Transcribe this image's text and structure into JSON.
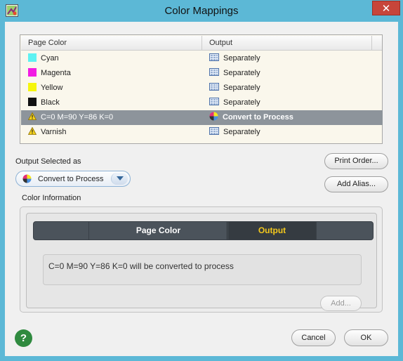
{
  "window": {
    "title": "Color Mappings"
  },
  "table": {
    "headers": {
      "page_color": "Page Color",
      "output": "Output"
    },
    "rows": [
      {
        "name": "Cyan",
        "swatch": "#5ef2f2",
        "output": "Separately"
      },
      {
        "name": "Magenta",
        "swatch": "#f21ce3",
        "output": "Separately"
      },
      {
        "name": "Yellow",
        "swatch": "#f6f60c",
        "output": "Separately"
      },
      {
        "name": "Black",
        "swatch": "#111111",
        "output": "Separately"
      },
      {
        "name": "C=0 M=90 Y=86 K=0",
        "icon": "warning-icon",
        "output": "Convert to Process",
        "selected": true
      },
      {
        "name": "Varnish",
        "icon": "warning-icon",
        "output": "Separately"
      }
    ]
  },
  "output_selected": {
    "label": "Output Selected as",
    "value": "Convert to Process"
  },
  "buttons": {
    "print_order": "Print Order...",
    "add_alias": "Add Alias...",
    "add": "Add...",
    "cancel": "Cancel",
    "ok": "OK",
    "help": "?"
  },
  "color_info": {
    "label": "Color Information",
    "tabs": {
      "page_color": "Page Color",
      "output": "Output"
    },
    "message": "C=0 M=90 Y=86 K=0 will be converted to process"
  }
}
